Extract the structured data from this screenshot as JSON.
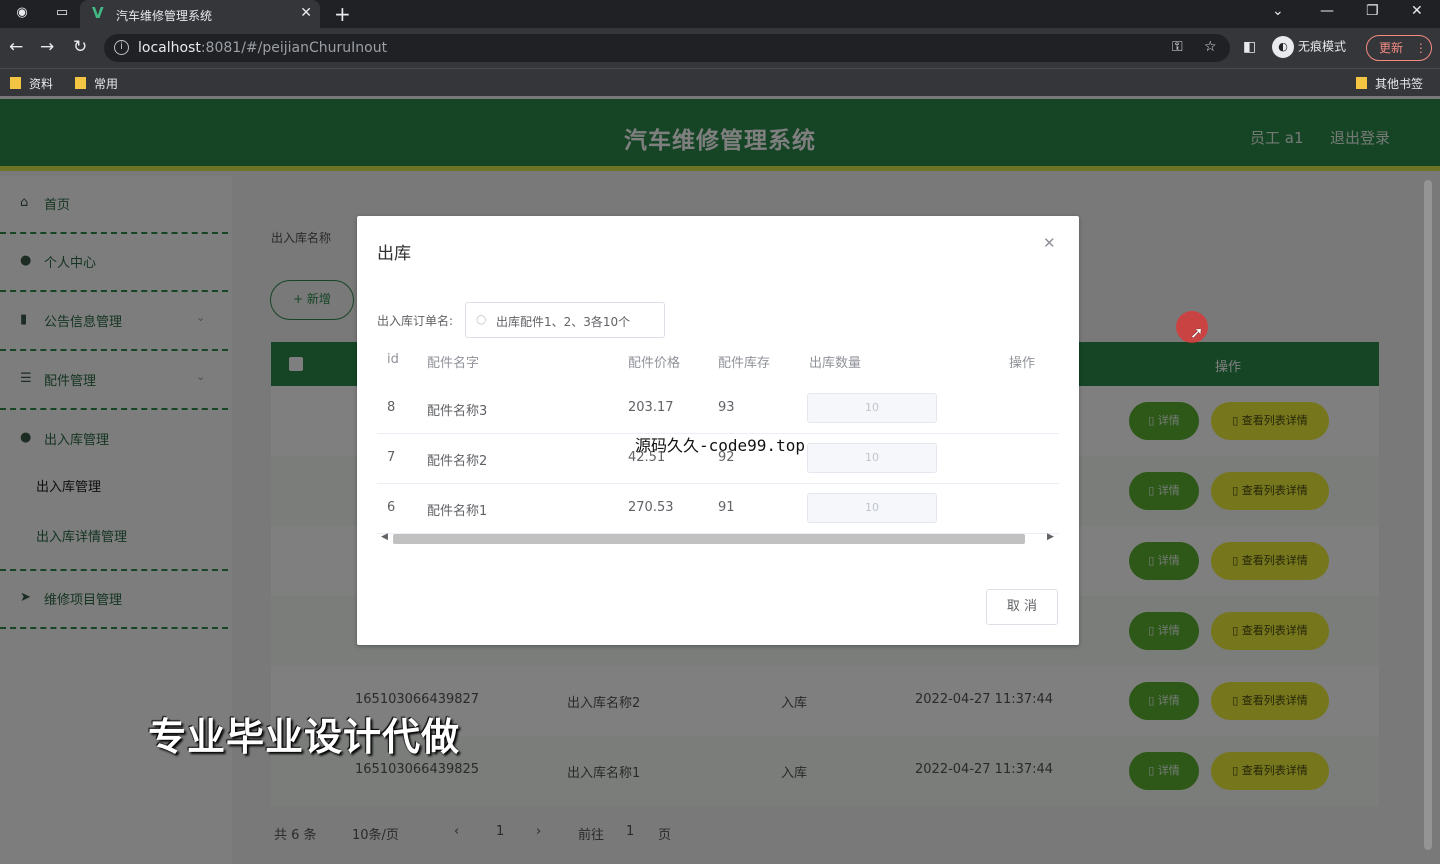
{
  "browser": {
    "tab_title": "汽车维修管理系统",
    "tab_favicon": "V",
    "url_host": "localhost",
    "url_rest": ":8081/#/peijianChuruInout",
    "incognito_label": "无痕模式",
    "update_label": "更新",
    "bookmarks": [
      "资料",
      "常用"
    ],
    "other_bookmarks": "其他书签"
  },
  "header": {
    "title": "汽车维修管理系统",
    "user": "员工 a1",
    "logout": "退出登录"
  },
  "sidebar": {
    "items": [
      {
        "label": "首页",
        "icon": "home-icon"
      },
      {
        "label": "个人中心",
        "icon": "user-icon"
      },
      {
        "label": "公告信息管理",
        "icon": "chart-icon"
      },
      {
        "label": "配件管理",
        "icon": "menu-icon"
      },
      {
        "label": "出入库管理",
        "icon": "circle-icon"
      },
      {
        "label": "维修项目管理",
        "icon": "send-icon"
      }
    ],
    "submenu": [
      "出入库管理",
      "出入库详情管理"
    ]
  },
  "main": {
    "search_label": "出入库名称",
    "add_label": "+ 新增",
    "ops_header": "操作",
    "row_buttons": {
      "detail": "详情",
      "list_detail": "查看列表详情"
    },
    "rows": [
      {
        "no": "165103066439827",
        "name": "出入库名称2",
        "type": "入库",
        "time": "2022-04-27 11:37:44"
      },
      {
        "no": "165103066439825",
        "name": "出入库名称1",
        "type": "入库",
        "time": "2022-04-27 11:37:44"
      }
    ],
    "pager": {
      "total": "共 6 条",
      "page_size": "10条/页",
      "current": "1",
      "goto": "前往",
      "goto_page": "1",
      "page_unit": "页"
    }
  },
  "dialog": {
    "title": "出库",
    "order_label": "出入库订单名:",
    "order_value": "出库配件1、2、3各10个",
    "columns": [
      "id",
      "配件名字",
      "配件价格",
      "配件库存",
      "出库数量",
      "操作"
    ],
    "rows": [
      {
        "id": "8",
        "name": "配件名称3",
        "price": "203.17",
        "stock": "93",
        "qty": "10"
      },
      {
        "id": "7",
        "name": "配件名称2",
        "price": "42.51",
        "stock": "92",
        "qty": "10"
      },
      {
        "id": "6",
        "name": "配件名称1",
        "price": "270.53",
        "stock": "91",
        "qty": "10"
      }
    ],
    "cancel_label": "取 消"
  },
  "overlay_texts": {
    "watermark": "源码久久-code99.top",
    "promo": "专业毕业设计代做"
  },
  "colors": {
    "brand_green": "#2b8a4b",
    "accent_yellow": "#d8e84a",
    "button_green": "#5cb030",
    "button_yellow": "#ecec3a"
  }
}
